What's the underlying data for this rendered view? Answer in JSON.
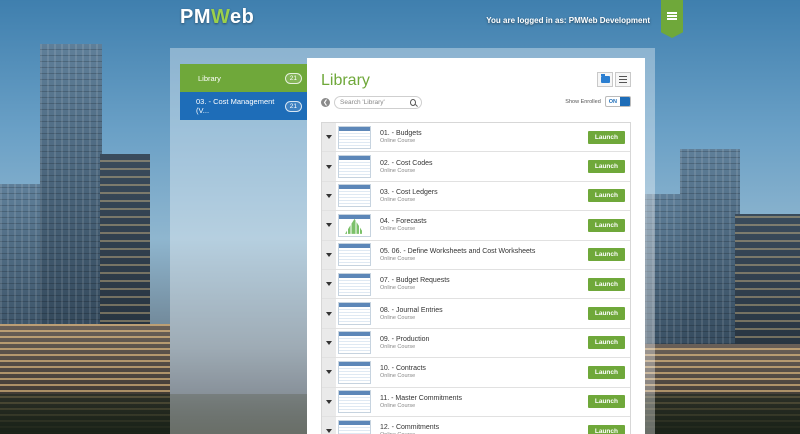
{
  "header": {
    "logo_prefix": "PM",
    "logo_accent": "W",
    "logo_suffix": "eb",
    "logged_in_text": "You are logged in as: PMWeb Development"
  },
  "colors": {
    "accent_green": "#6fa83a",
    "accent_blue": "#1e6db8"
  },
  "sidebar": {
    "items": [
      {
        "label": "Library",
        "count": "21"
      },
      {
        "label": "03. - Cost Management (V...",
        "count": "21"
      }
    ]
  },
  "main": {
    "title": "Library",
    "search_placeholder": "Search 'Library'",
    "show_enrolled_label": "Show Enrolled",
    "toggle_label": "ON",
    "launch_label": "Launch",
    "courses": [
      {
        "title": "01. - Budgets",
        "subtitle": "Online Course"
      },
      {
        "title": "02. - Cost Codes",
        "subtitle": "Online Course"
      },
      {
        "title": "03. - Cost Ledgers",
        "subtitle": "Online Course"
      },
      {
        "title": "04. - Forecasts",
        "subtitle": "Online Course"
      },
      {
        "title": "05. 06. - Define Worksheets and Cost Worksheets",
        "subtitle": "Online Course"
      },
      {
        "title": "07. - Budget Requests",
        "subtitle": "Online Course"
      },
      {
        "title": "08. - Journal Entries",
        "subtitle": "Online Course"
      },
      {
        "title": "09. - Production",
        "subtitle": "Online Course"
      },
      {
        "title": "10. - Contracts",
        "subtitle": "Online Course"
      },
      {
        "title": "11. - Master Commitments",
        "subtitle": "Online Course"
      },
      {
        "title": "12. - Commitments",
        "subtitle": "Online Course"
      }
    ]
  }
}
